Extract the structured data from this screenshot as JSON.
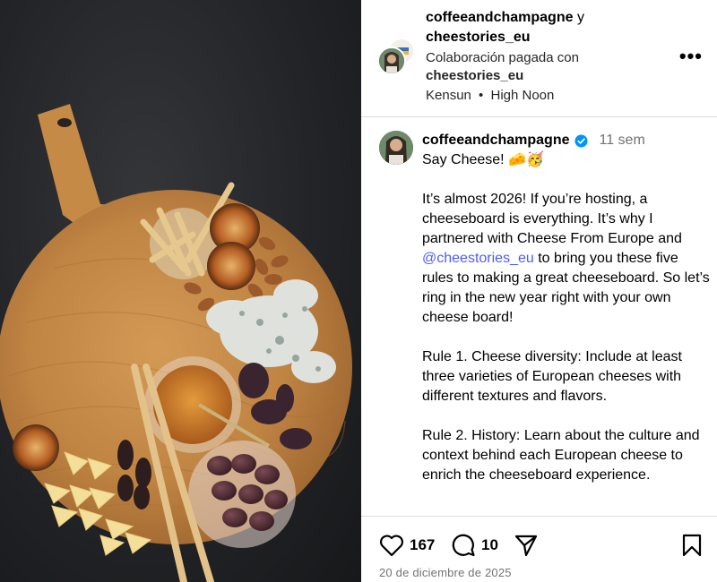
{
  "header": {
    "user1": "coffeeandchampagne",
    "conjunction": "y",
    "user2": "cheestories_eu",
    "paid_label": "Colaboración pagada con",
    "paid_partner": "cheestories_eu",
    "audio_artist": "Kensun",
    "separator": "•",
    "audio_title": "High Noon",
    "more_label": "•••"
  },
  "caption": {
    "username": "coffeeandchampagne",
    "time_ago": "11 sem",
    "line1": "Say Cheese! 🧀🥳",
    "p1_a": "It’s almost 2026! If you’re hosting, a cheeseboard is everything. It’s why I partnered with Cheese From Europe and ",
    "p1_mention": "@cheestories_eu",
    "p1_b": " to bring you these five rules to making a great cheeseboard. So let’s ring in the new year right with your own cheese board!",
    "p2": "Rule 1. Cheese diversity: Include at least three varieties of European cheeses with different textures and flavors.",
    "p3": "Rule 2. History: Learn about the culture and context behind each European cheese to enrich the cheeseboard experience."
  },
  "actions": {
    "likes": "167",
    "comments": "10",
    "date": "20 de diciembre de 2025"
  },
  "colors": {
    "link": "#4a5df9",
    "verified": "#0095f6",
    "muted": "#737373",
    "divider": "#dbdbdb"
  }
}
